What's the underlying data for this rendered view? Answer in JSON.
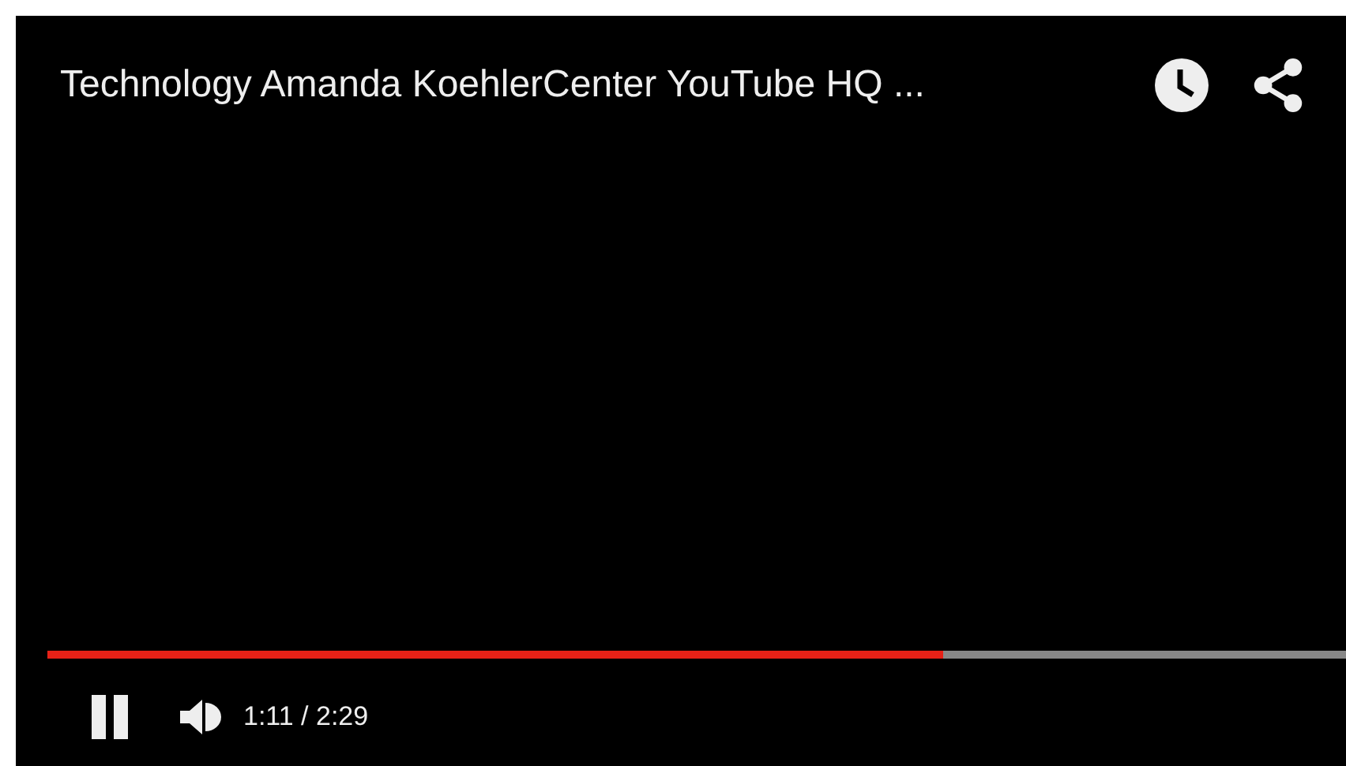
{
  "player": {
    "title": "Technology Amanda KoehlerCenter YouTube HQ ...",
    "playing": true,
    "muted": false,
    "progress": {
      "level": 0.69
    },
    "time": "1:11 / 2:29"
  }
}
